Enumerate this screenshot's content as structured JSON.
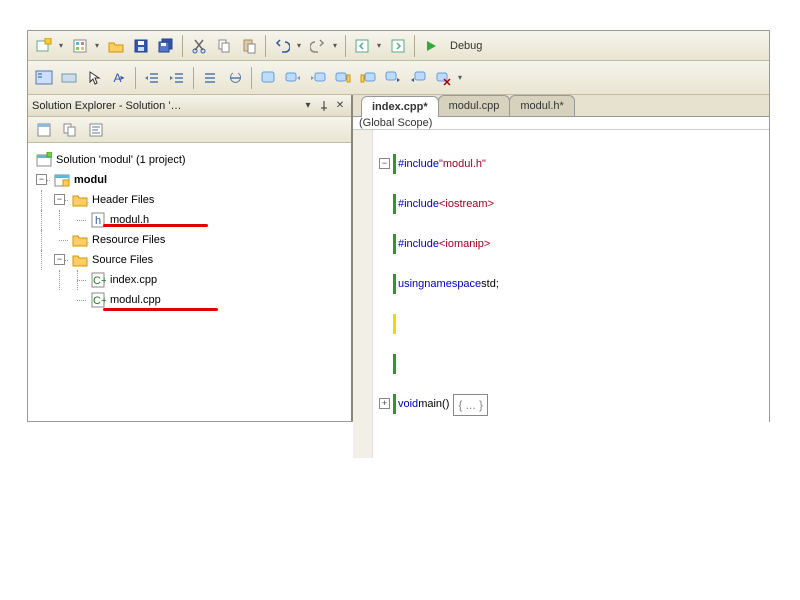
{
  "toolbar": {
    "config_label": "Debug"
  },
  "solution_explorer": {
    "title": "Solution Explorer - Solution '…",
    "root": "Solution 'modul' (1 project)",
    "project": "modul",
    "folders": {
      "header": "Header Files",
      "resource": "Resource Files",
      "source": "Source Files"
    },
    "files": {
      "modul_h": "modul.h",
      "index_cpp": "index.cpp",
      "modul_cpp": "modul.cpp"
    }
  },
  "editor": {
    "tabs": [
      "index.cpp*",
      "modul.cpp",
      "modul.h*"
    ],
    "active_tab": 0,
    "scope": "(Global Scope)",
    "code": {
      "l1_pre": "#include",
      "l1_arg": "\"modul.h\"",
      "l2_pre": "#include",
      "l2_arg": "<iostream>",
      "l3_pre": "#include",
      "l3_arg": "<iomanip>",
      "l4_using": "using",
      "l4_ns": "namespace",
      "l4_std": "std",
      "l7_void": "void",
      "l7_main": "main()",
      "l7_fold": "{ ... }"
    }
  }
}
